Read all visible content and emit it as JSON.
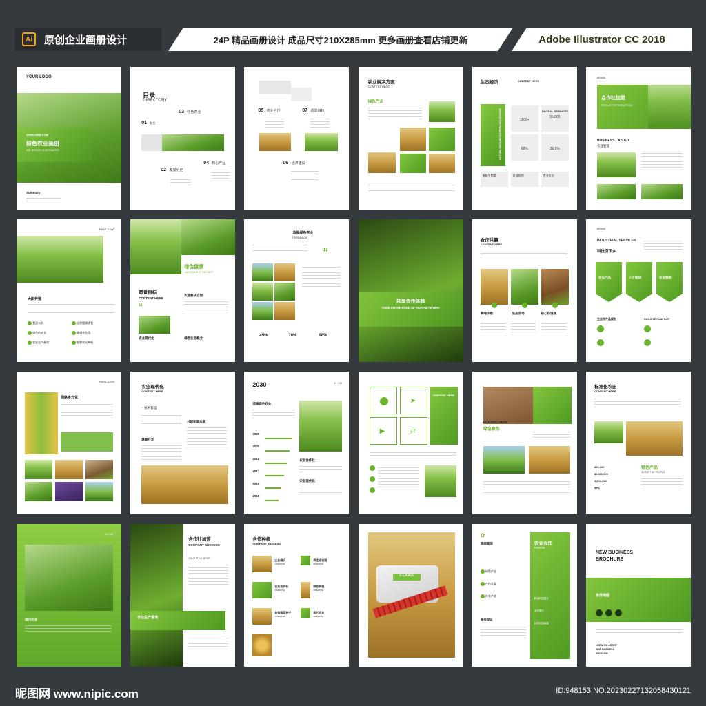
{
  "header": {
    "app_icon": "Ai",
    "left_title": "原创企业画册设计",
    "middle_title": "24P 精品画册设计 成品尺寸210X285mm 更多画册查看店铺更新",
    "right_title": "Adobe Illustrator CC 2018"
  },
  "p1": {
    "logo": "YOUR LOGO",
    "web": "WWW.WEB.COM",
    "title": "绿色农业画册",
    "sub": "WE SERVE CUSTOMERS",
    "summary": "Summary"
  },
  "p2": {
    "title": "目录",
    "title_en": "DIRECTORY",
    "tag": "CONTENTS TABLE",
    "items": [
      {
        "num": "01",
        "label": "前言"
      },
      {
        "num": "03",
        "label": "特色农业"
      },
      {
        "num": "02",
        "label": "发展历史"
      },
      {
        "num": "04",
        "label": "核心产品"
      }
    ]
  },
  "p3": {
    "items": [
      {
        "num": "05",
        "label": "农业合作"
      },
      {
        "num": "07",
        "label": "愿景目标"
      },
      {
        "num": "06",
        "label": "经济建设"
      }
    ]
  },
  "p4": {
    "title": "农业解决方案",
    "sub": "CONTENT HERE",
    "label": "绿色产业"
  },
  "p5": {
    "title": "生态经济",
    "sub": "CONTENT HERE",
    "side": "SERVICE FOR PATIENTS IMPROVE THE LIFE",
    "stats": [
      "1500+",
      "35.000",
      "68%",
      "36.8%"
    ],
    "stat_label": "GLOBAL SERVICES",
    "tags": [
      "有机生物育",
      "环境规划",
      "农业优化"
    ]
  },
  "p6": {
    "brand": "BRAND",
    "title": "合作社加盟",
    "sub": "PRODUCT INTRODUCTION",
    "layout": "BUSINESS LAYOUT",
    "layout_cn": "农业管理"
  },
  "p7": {
    "page": "PAGE-01/02",
    "title": "大田养殖",
    "items": [
      "食品有机",
      "自然健康规划",
      "绿色的农业",
      "休闲农业园",
      "农业生产基地",
      "智慧农业种植"
    ]
  },
  "p8": {
    "title": "绿色健康",
    "sub": "CUSTOMER IS THE BEST",
    "goal": "愿景目标",
    "content": "CONTENT HERE",
    "t1": "农业解决方案",
    "t2": "农业现代化",
    "t3": "绿色生态概念"
  },
  "p9": {
    "title": "造福绿色农业",
    "sub": "FEEDBACK",
    "stats": [
      "45%",
      "78%",
      "98%"
    ]
  },
  "p10": {
    "title": "共享合作体验",
    "sub": "TAKE ADVANTAGE OF OUR NETWORK"
  },
  "p11": {
    "title": "合作共赢",
    "sub": "CONTENT HERE",
    "labels": [
      "高端作物",
      "生态农场",
      "核心价值观"
    ]
  },
  "p12": {
    "brand": "BRAND",
    "title": "INDUSTRIAL SERVICES",
    "title_cn": "科技引下乡",
    "arrows": [
      "农业产品",
      "人才培训",
      "农业服务"
    ],
    "sub1": "生态农产品规划",
    "sub2": "INDUSTRY LAYOUT"
  },
  "p13": {
    "page": "PAGE-01/02",
    "title": "网络多元化"
  },
  "p14": {
    "title": "农业现代化",
    "sub": "CONTENT HERE",
    "tag": "技术管理",
    "t1": "健康开发",
    "t2": "共建和谐未来"
  },
  "p15": {
    "year": "2030",
    "page": "01 / 02",
    "title": "造福绿色农业",
    "years": [
      "2025",
      "2020",
      "2018",
      "2017",
      "2016",
      "2015"
    ],
    "t1": "农业合作社",
    "t2": "农业现代化"
  },
  "p16": {
    "banner": "CONTENT HERE"
  },
  "p17": {
    "content": "CONTENT HERE",
    "title": "绿色食品"
  },
  "p18": {
    "title": "标准化农田",
    "sub": "CONTENT HERE",
    "t1": "特色产品",
    "t2": "SERVE THE PEOPLE",
    "nums": [
      "800,000",
      "86,000,000",
      "5,800,000",
      "95%"
    ]
  },
  "p19": {
    "page": "01 / 02",
    "label": "现代农业"
  },
  "p20": {
    "title": "合作社加盟",
    "sub": "COMPANY SUCCESS",
    "sub2": "YOUR TITLE HERE",
    "banner": "农业生产基地"
  },
  "p21": {
    "title": "合作种植",
    "sub": "COMPANY SUCCESS",
    "items": [
      "企业概况",
      "养生态农园",
      "农业合作社",
      "特色种植",
      "谷物蔬菜种子",
      "现代农业"
    ],
    "tag": "CREATIVE"
  },
  "p22": {
    "brand": "CLAAS"
  },
  "p23": {
    "title": "农业合作",
    "sub": "VISION",
    "t1": "精细管理",
    "items": [
      "绿色产业",
      "合作发展",
      "技术产能"
    ],
    "t2": "服务保证",
    "items2": [
      "和谐科技进步",
      "乡村振兴",
      "共同创造幸福"
    ]
  },
  "p24": {
    "title1": "NEW BUSINESS",
    "title2": "BROCHURE",
    "label": "世界地图",
    "foot": [
      "CREATIVE ARTIST",
      "NEW BUSINESS",
      "BROCHER"
    ]
  },
  "footer": {
    "site": "昵图网 www.nipic.com",
    "id": "ID:948153 NO:20230227132058430121"
  },
  "colors": {
    "accent": "#6ab42d",
    "background": "#353a3f"
  }
}
